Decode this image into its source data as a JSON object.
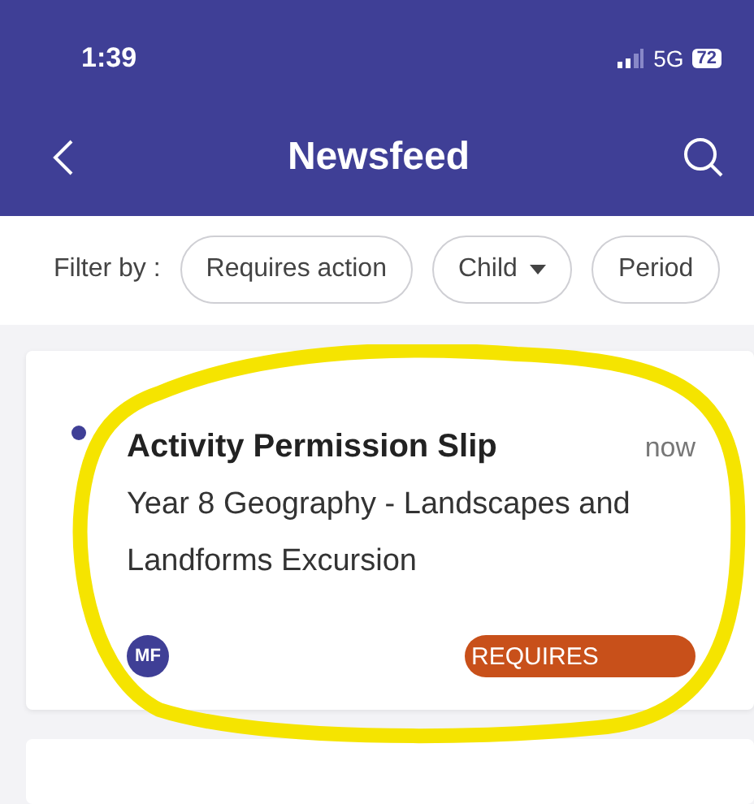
{
  "status_bar": {
    "time": "1:39",
    "network": "5G",
    "battery": "72"
  },
  "header": {
    "title": "Newsfeed"
  },
  "filter": {
    "label": "Filter by :",
    "chips": [
      {
        "label": "Requires action",
        "kind": "toggle"
      },
      {
        "label": "Child",
        "kind": "dropdown"
      },
      {
        "label": "Period",
        "kind": "toggle"
      }
    ]
  },
  "feed": [
    {
      "title": "Activity Permission Slip",
      "time": "now",
      "body": "Year 8 Geography - Landscapes and Landforms Excursion",
      "unread": true,
      "avatar": "MF",
      "badge": "REQUIRES"
    }
  ]
}
